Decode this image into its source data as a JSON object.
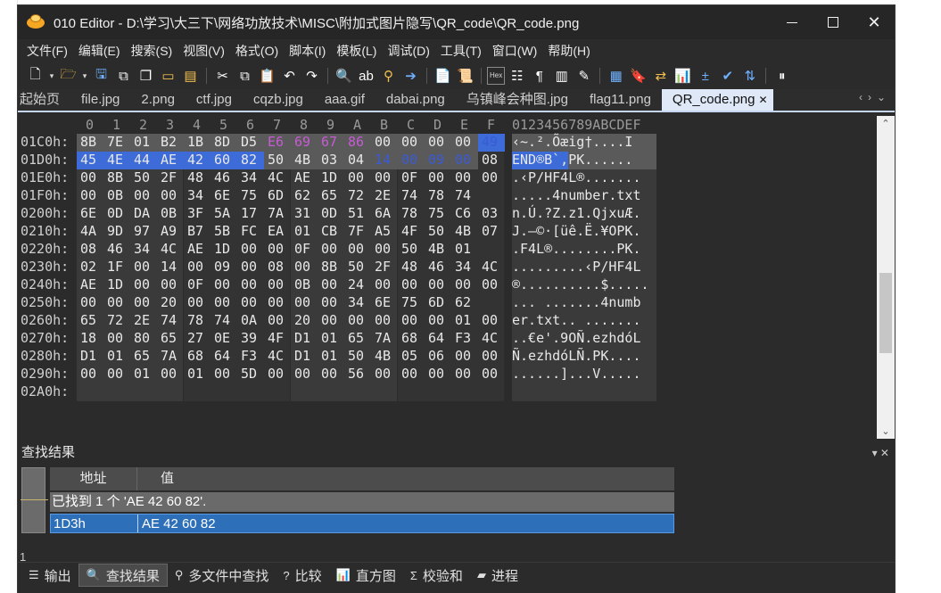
{
  "window": {
    "title": "010 Editor - D:\\学习\\大三下\\网络功放技术\\MISC\\附加式图片隐写\\QR_code\\QR_code.png"
  },
  "menu": [
    "文件(F)",
    "编辑(E)",
    "搜索(S)",
    "视图(V)",
    "格式(O)",
    "脚本(I)",
    "模板(L)",
    "调试(D)",
    "工具(T)",
    "窗口(W)",
    "帮助(H)"
  ],
  "toolbar_icons": [
    "new-file-icon",
    "open-folder-icon",
    "save-icon",
    "save-as-icon",
    "save-all-icon",
    "open-folder2-icon",
    "open-recent-icon",
    "cut-icon",
    "copy-icon",
    "paste-icon",
    "undo-icon",
    "redo-icon",
    "find-icon",
    "find-replace-icon",
    "find-in-files-icon",
    "goto-icon",
    "script-icon",
    "template-icon",
    "hex-mode-icon",
    "text-mode-icon",
    "pilcrow-icon",
    "columns-icon",
    "highlight-icon",
    "calculator-icon",
    "bookmark-icon",
    "swap-icon",
    "histogram-icon",
    "compare-icon",
    "checksum-icon",
    "base-convert-icon",
    "pause-icon"
  ],
  "tabs": [
    "起始页",
    "file.jpg",
    "2.png",
    "ctf.jpg",
    "cqzb.jpg",
    "aaa.gif",
    "dabai.png",
    "乌镇峰会种图.jpg",
    "flag11.png",
    "QR_code.png"
  ],
  "active_tab": "QR_code.png",
  "hex": {
    "columns": [
      "0",
      "1",
      "2",
      "3",
      "4",
      "5",
      "6",
      "7",
      "8",
      "9",
      "A",
      "B",
      "C",
      "D",
      "E",
      "F"
    ],
    "ascii_header": "0123456789ABCDEF",
    "rows": [
      {
        "addr": "01C0h:",
        "bytes": [
          "8B",
          "7E",
          "01",
          "B2",
          "1B",
          "8D",
          "D5",
          "E6",
          "69",
          "67",
          "86",
          "00",
          "00",
          "00",
          "00",
          "49"
        ],
        "ascii": "‹~.².Õæig†....I"
      },
      {
        "addr": "01D0h:",
        "bytes": [
          "45",
          "4E",
          "44",
          "AE",
          "42",
          "60",
          "82",
          "50",
          "4B",
          "03",
          "04",
          "14",
          "00",
          "09",
          "00",
          "08"
        ],
        "ascii": "END®B`‚PK......"
      },
      {
        "addr": "01E0h:",
        "bytes": [
          "00",
          "8B",
          "50",
          "2F",
          "48",
          "46",
          "34",
          "4C",
          "AE",
          "1D",
          "00",
          "00",
          "0F",
          "00",
          "00",
          "00"
        ],
        "ascii": ".‹P/HF4L®......."
      },
      {
        "addr": "01F0h:",
        "bytes": [
          "00",
          "0B",
          "00",
          "00",
          "34",
          "6E",
          "75",
          "6D",
          "62",
          "65",
          "72",
          "2E",
          "74",
          "78",
          "74"
        ],
        "ascii": ".....4number.txt"
      },
      {
        "addr": "0200h:",
        "bytes": [
          "6E",
          "0D",
          "DA",
          "0B",
          "3F",
          "5A",
          "17",
          "7A",
          "31",
          "0D",
          "51",
          "6A",
          "78",
          "75",
          "C6",
          "03"
        ],
        "ascii": "n.Ú.?Z.z1.QjxuÆ."
      },
      {
        "addr": "0210h:",
        "bytes": [
          "4A",
          "9D",
          "97",
          "A9",
          "B7",
          "5B",
          "FC",
          "EA",
          "01",
          "CB",
          "7F",
          "A5",
          "4F",
          "50",
          "4B",
          "07"
        ],
        "ascii": "J.—©·[üê.Ë.¥OPK."
      },
      {
        "addr": "0220h:",
        "bytes": [
          "08",
          "46",
          "34",
          "4C",
          "AE",
          "1D",
          "00",
          "00",
          "0F",
          "00",
          "00",
          "00",
          "50",
          "4B",
          "01"
        ],
        "ascii": ".F4L®........PK."
      },
      {
        "addr": "0230h:",
        "bytes": [
          "02",
          "1F",
          "00",
          "14",
          "00",
          "09",
          "00",
          "08",
          "00",
          "8B",
          "50",
          "2F",
          "48",
          "46",
          "34",
          "4C"
        ],
        "ascii": ".........‹P/HF4L"
      },
      {
        "addr": "0240h:",
        "bytes": [
          "AE",
          "1D",
          "00",
          "00",
          "0F",
          "00",
          "00",
          "00",
          "0B",
          "00",
          "24",
          "00",
          "00",
          "00",
          "00",
          "00"
        ],
        "ascii": "®..........$....."
      },
      {
        "addr": "0250h:",
        "bytes": [
          "00",
          "00",
          "00",
          "20",
          "00",
          "00",
          "00",
          "00",
          "00",
          "00",
          "34",
          "6E",
          "75",
          "6D",
          "62"
        ],
        "ascii": "... .......4numb"
      },
      {
        "addr": "0260h:",
        "bytes": [
          "65",
          "72",
          "2E",
          "74",
          "78",
          "74",
          "0A",
          "00",
          "20",
          "00",
          "00",
          "00",
          "00",
          "00",
          "01",
          "00"
        ],
        "ascii": "er.txt.. ......."
      },
      {
        "addr": "0270h:",
        "bytes": [
          "18",
          "00",
          "80",
          "65",
          "27",
          "0E",
          "39",
          "4F",
          "D1",
          "01",
          "65",
          "7A",
          "68",
          "64",
          "F3",
          "4C"
        ],
        "ascii": "..€e'.9OÑ.ezhdóL"
      },
      {
        "addr": "0280h:",
        "bytes": [
          "D1",
          "01",
          "65",
          "7A",
          "68",
          "64",
          "F3",
          "4C",
          "D1",
          "01",
          "50",
          "4B",
          "05",
          "06",
          "00",
          "00"
        ],
        "ascii": "Ñ.ezhdóLÑ.PK...."
      },
      {
        "addr": "0290h:",
        "bytes": [
          "00",
          "00",
          "01",
          "00",
          "01",
          "00",
          "5D",
          "00",
          "00",
          "00",
          "56",
          "00",
          "00",
          "00",
          "00",
          "00"
        ],
        "ascii": "......]...V....."
      },
      {
        "addr": "02A0h:",
        "bytes": [],
        "ascii": ""
      }
    ]
  },
  "find": {
    "title": "查找结果",
    "col_addr": "地址",
    "col_value": "值",
    "summary": "已找到 1 个 'AE 42 60 82'.",
    "result_addr": "1D3h",
    "result_value": "AE 42 60 82",
    "count": "1"
  },
  "bottom_tabs": [
    {
      "label": "输出",
      "icon": "output-icon"
    },
    {
      "label": "查找结果",
      "icon": "search-results-icon"
    },
    {
      "label": "多文件中查找",
      "icon": "find-in-files-icon"
    },
    {
      "label": "比较",
      "icon": "compare-icon"
    },
    {
      "label": "直方图",
      "icon": "histogram-icon"
    },
    {
      "label": "校验和",
      "icon": "checksum-icon"
    },
    {
      "label": "进程",
      "icon": "process-icon"
    }
  ],
  "colors": {
    "selection": "#3d6bd8",
    "highlight_purple": "#c75bd3",
    "result_row": "#2d6fb8"
  }
}
